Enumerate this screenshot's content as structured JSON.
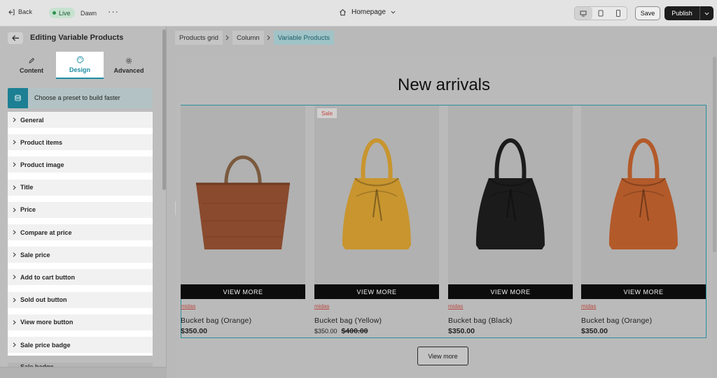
{
  "topbar": {
    "back_label": "Back",
    "status_label": "Live",
    "theme_name": "Dawn",
    "more_label": "···",
    "page_selector": "Homepage",
    "save_label": "Save",
    "publish_label": "Publish"
  },
  "sidebar": {
    "title": "Editing Variable Products",
    "tabs": [
      {
        "label": "Content",
        "icon": "pencil-icon"
      },
      {
        "label": "Design",
        "icon": "palette-icon",
        "active": true
      },
      {
        "label": "Advanced",
        "icon": "gear-icon"
      }
    ],
    "preset_label": "Choose a preset to build faster",
    "sections": [
      "General",
      "Product items",
      "Product image",
      "Title",
      "Price",
      "Compare at price",
      "Sale price",
      "Add to cart button",
      "Sold out button",
      "View more button",
      "Sale price badge"
    ],
    "peek_section": "Sale badge"
  },
  "breadcrumbs": [
    "Products grid",
    "Column",
    "Variable Products"
  ],
  "canvas": {
    "heading": "New arrivals",
    "view_more_label": "View more",
    "products": [
      {
        "name": "Bucket bag (Orange)",
        "vendor": "midas",
        "price": "$350.00",
        "compare_price": "",
        "badge": "",
        "button": "VIEW MORE",
        "bag_color": "#8a4a2e",
        "style": "woven"
      },
      {
        "name": "Bucket bag (Yellow)",
        "vendor": "midas",
        "price": "$350.00",
        "compare_price": "$400.00",
        "badge": "Sale",
        "button": "VIEW MORE",
        "bag_color": "#c8952f",
        "style": "bucket"
      },
      {
        "name": "Bucket bag (Black)",
        "vendor": "midas",
        "price": "$350.00",
        "compare_price": "",
        "badge": "",
        "button": "VIEW MORE",
        "bag_color": "#1b1b1b",
        "style": "bucket"
      },
      {
        "name": "Bucket bag (Orange)",
        "vendor": "midas",
        "price": "$350.00",
        "compare_price": "",
        "badge": "",
        "button": "VIEW MORE",
        "bag_color": "#b35a2a",
        "style": "bucket"
      }
    ]
  },
  "colors": {
    "accent": "#1d8ea6",
    "sale": "#c2473f"
  }
}
